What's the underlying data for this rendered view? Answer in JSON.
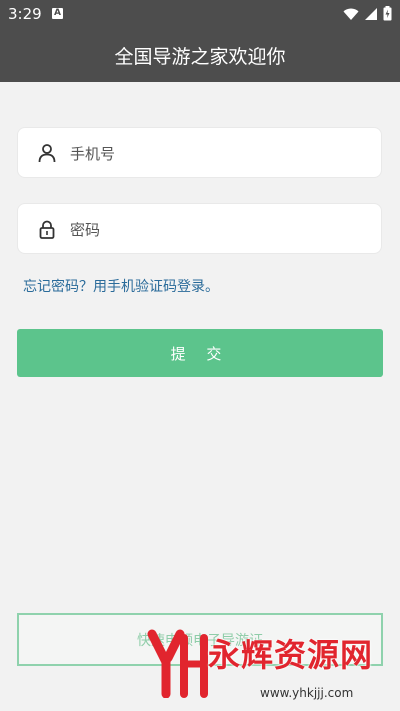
{
  "status_bar": {
    "time": "3:29",
    "notification_icon": "A",
    "icons": [
      "wifi-icon",
      "cellular-signal-icon",
      "battery-charging-icon"
    ]
  },
  "app_bar": {
    "title": "全国导游之家欢迎你"
  },
  "form": {
    "phone": {
      "placeholder": "手机号",
      "value": "",
      "icon": "user-icon"
    },
    "password": {
      "placeholder": "密码",
      "value": "",
      "icon": "lock-icon"
    },
    "forgot_link": "忘记密码？用手机验证码登录。",
    "submit_label": "提 交"
  },
  "quick_apply_label": "快速申领电子导游证",
  "watermark": {
    "brand": "永辉资源网",
    "url": "www.yhkjjj.com"
  },
  "colors": {
    "app_bar": "#4d4d4d",
    "background": "#f2f2f2",
    "accent_green": "#5cc48c",
    "link_blue": "#2a6b9a",
    "watermark_red": "#e1252e"
  }
}
